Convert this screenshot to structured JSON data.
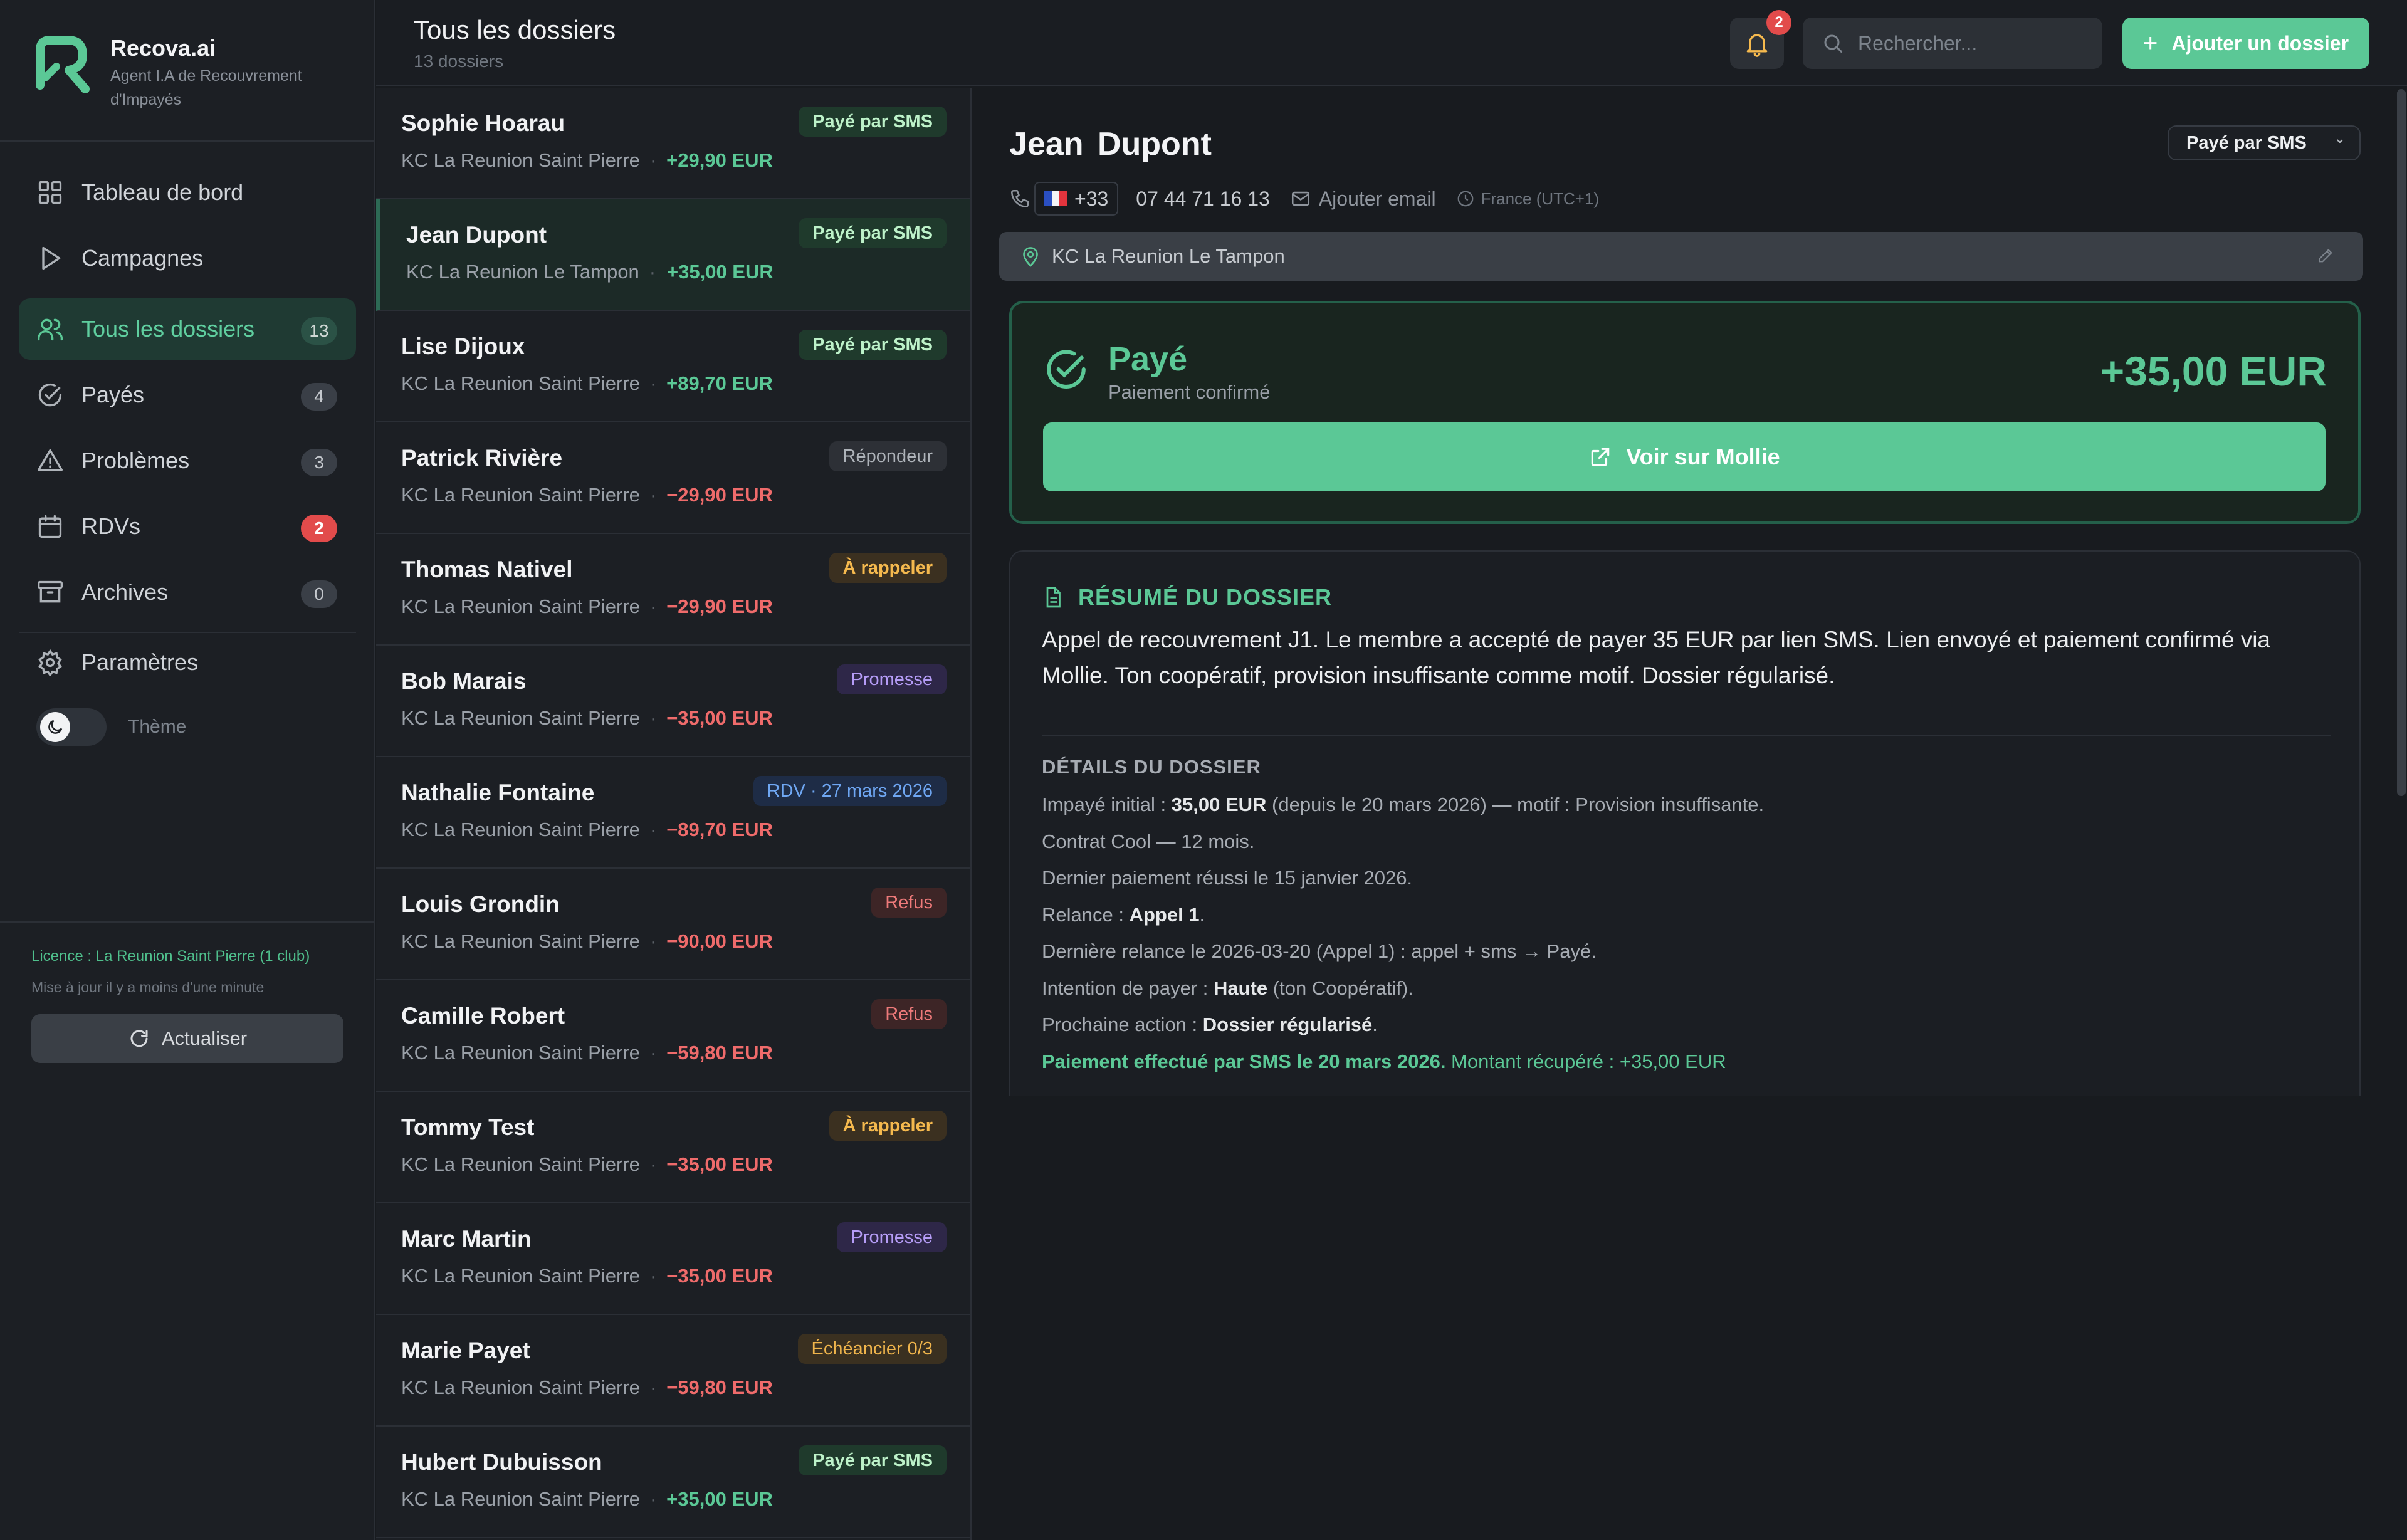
{
  "brand": {
    "name": "Recova.ai",
    "subtitle": "Agent I.A de Recouvrement d'Impayés"
  },
  "nav": [
    {
      "label": "Tableau de bord",
      "icon": "dashboard-icon"
    },
    {
      "label": "Campagnes",
      "icon": "play-icon"
    },
    {
      "label": "Tous les dossiers",
      "icon": "users-icon",
      "count": "13",
      "active": true
    },
    {
      "label": "Payés",
      "icon": "check-circle-icon",
      "count": "4"
    },
    {
      "label": "Problèmes",
      "icon": "warning-icon",
      "count": "3"
    },
    {
      "label": "RDVs",
      "icon": "calendar-icon",
      "count": "2",
      "alert": true
    },
    {
      "label": "Archives",
      "icon": "archive-icon",
      "count": "0"
    },
    {
      "label": "Paramètres",
      "icon": "gear-icon"
    }
  ],
  "theme": {
    "label": "Thème",
    "mode": "dark"
  },
  "footer": {
    "license": "Licence : La Reunion Saint Pierre (1 club)",
    "updated": "Mise à jour il y a moins d'une minute",
    "refresh_label": "Actualiser"
  },
  "header": {
    "title": "Tous les dossiers",
    "count_label": "13 dossiers",
    "notifications": "2",
    "search_placeholder": "Rechercher...",
    "add_label": "Ajouter un dossier"
  },
  "dossiers": [
    {
      "name": "Sophie Hoarau",
      "club": "KC La Reunion Saint Pierre",
      "amount": "+29,90 EUR",
      "sign": "pos",
      "badge": "Payé par SMS",
      "badge_type": "sms"
    },
    {
      "name": "Jean Dupont",
      "club": "KC La Reunion Le Tampon",
      "amount": "+35,00 EUR",
      "sign": "pos",
      "badge": "Payé par SMS",
      "badge_type": "sms",
      "selected": true
    },
    {
      "name": "Lise Dijoux",
      "club": "KC La Reunion Saint Pierre",
      "amount": "+89,70 EUR",
      "sign": "pos",
      "badge": "Payé par SMS",
      "badge_type": "sms"
    },
    {
      "name": "Patrick Rivière",
      "club": "KC La Reunion Saint Pierre",
      "amount": "−29,90 EUR",
      "sign": "neg",
      "badge": "Répondeur",
      "badge_type": "rep"
    },
    {
      "name": "Thomas Nativel",
      "club": "KC La Reunion Saint Pierre",
      "amount": "−29,90 EUR",
      "sign": "neg",
      "badge": "À rappeler",
      "badge_type": "call"
    },
    {
      "name": "Bob Marais",
      "club": "KC La Reunion Saint Pierre",
      "amount": "−35,00 EUR",
      "sign": "neg",
      "badge": "Promesse",
      "badge_type": "prom"
    },
    {
      "name": "Nathalie Fontaine",
      "club": "KC La Reunion Saint Pierre",
      "amount": "−89,70 EUR",
      "sign": "neg",
      "badge": "RDV · 27 mars 2026",
      "badge_type": "rdv"
    },
    {
      "name": "Louis Grondin",
      "club": "KC La Reunion Saint Pierre",
      "amount": "−90,00 EUR",
      "sign": "neg",
      "badge": "Refus",
      "badge_type": "ref"
    },
    {
      "name": "Camille Robert",
      "club": "KC La Reunion Saint Pierre",
      "amount": "−59,80 EUR",
      "sign": "neg",
      "badge": "Refus",
      "badge_type": "ref"
    },
    {
      "name": "Tommy Test",
      "club": "KC La Reunion Saint Pierre",
      "amount": "−35,00 EUR",
      "sign": "neg",
      "badge": "À rappeler",
      "badge_type": "call"
    },
    {
      "name": "Marc Martin",
      "club": "KC La Reunion Saint Pierre",
      "amount": "−35,00 EUR",
      "sign": "neg",
      "badge": "Promesse",
      "badge_type": "prom"
    },
    {
      "name": "Marie Payet",
      "club": "KC La Reunion Saint Pierre",
      "amount": "−59,80 EUR",
      "sign": "neg",
      "badge": "Échéancier 0/3",
      "badge_type": "ech"
    },
    {
      "name": "Hubert Dubuisson",
      "club": "KC La Reunion Saint Pierre",
      "amount": "+35,00 EUR",
      "sign": "pos",
      "badge": "Payé par SMS",
      "badge_type": "sms"
    }
  ],
  "detail": {
    "name": "Jean Dupont",
    "status": "Payé par SMS",
    "country_code": "+33",
    "phone": "07 44 71 16 13",
    "email_label": "Ajouter email",
    "timezone": "France (UTC+1)",
    "location": "KC La Reunion Le Tampon",
    "paid_title": "Payé",
    "paid_subtitle": "Paiement confirmé",
    "paid_amount": "+35,00 EUR",
    "mollie_label": "Voir sur Mollie",
    "summary_title": "RÉSUMÉ DU DOSSIER",
    "summary_text": "Appel de recouvrement J1. Le membre a accepté de payer 35 EUR par lien SMS. Lien envoyé et paiement confirmé via Mollie. Ton coopératif, provision insuffisante comme motif. Dossier régularisé.",
    "details_title": "DÉTAILS DU DOSSIER",
    "details": [
      {
        "pre": "Impayé initial : ",
        "bold": "35,00 EUR",
        "post": " (depuis le 20 mars 2026) — motif : Provision insuffisante."
      },
      {
        "pre": "Contrat Cool — 12 mois.",
        "bold": "",
        "post": ""
      },
      {
        "pre": "Dernier paiement réussi le 15 janvier 2026.",
        "bold": "",
        "post": ""
      },
      {
        "pre": "Relance : ",
        "bold": "Appel 1",
        "post": "."
      },
      {
        "pre": "Dernière relance le 2026-03-20 (Appel 1) : appel + sms → Payé.",
        "bold": "",
        "post": ""
      },
      {
        "pre": "Intention de payer : ",
        "bold": "Haute",
        "post": " (ton Coopératif)."
      },
      {
        "pre": "Prochaine action : ",
        "bold": "Dossier régularisé",
        "post": "."
      },
      {
        "pre": "",
        "bold": "Paiement effectué par SMS le 20 mars 2026.",
        "post": " Montant récupéré : +35,00 EUR",
        "green": true
      }
    ]
  },
  "colors": {
    "accent": "#5bc896",
    "danger": "#ef6b6b",
    "background": "#181b1f",
    "sidebar": "#1c1f24"
  }
}
